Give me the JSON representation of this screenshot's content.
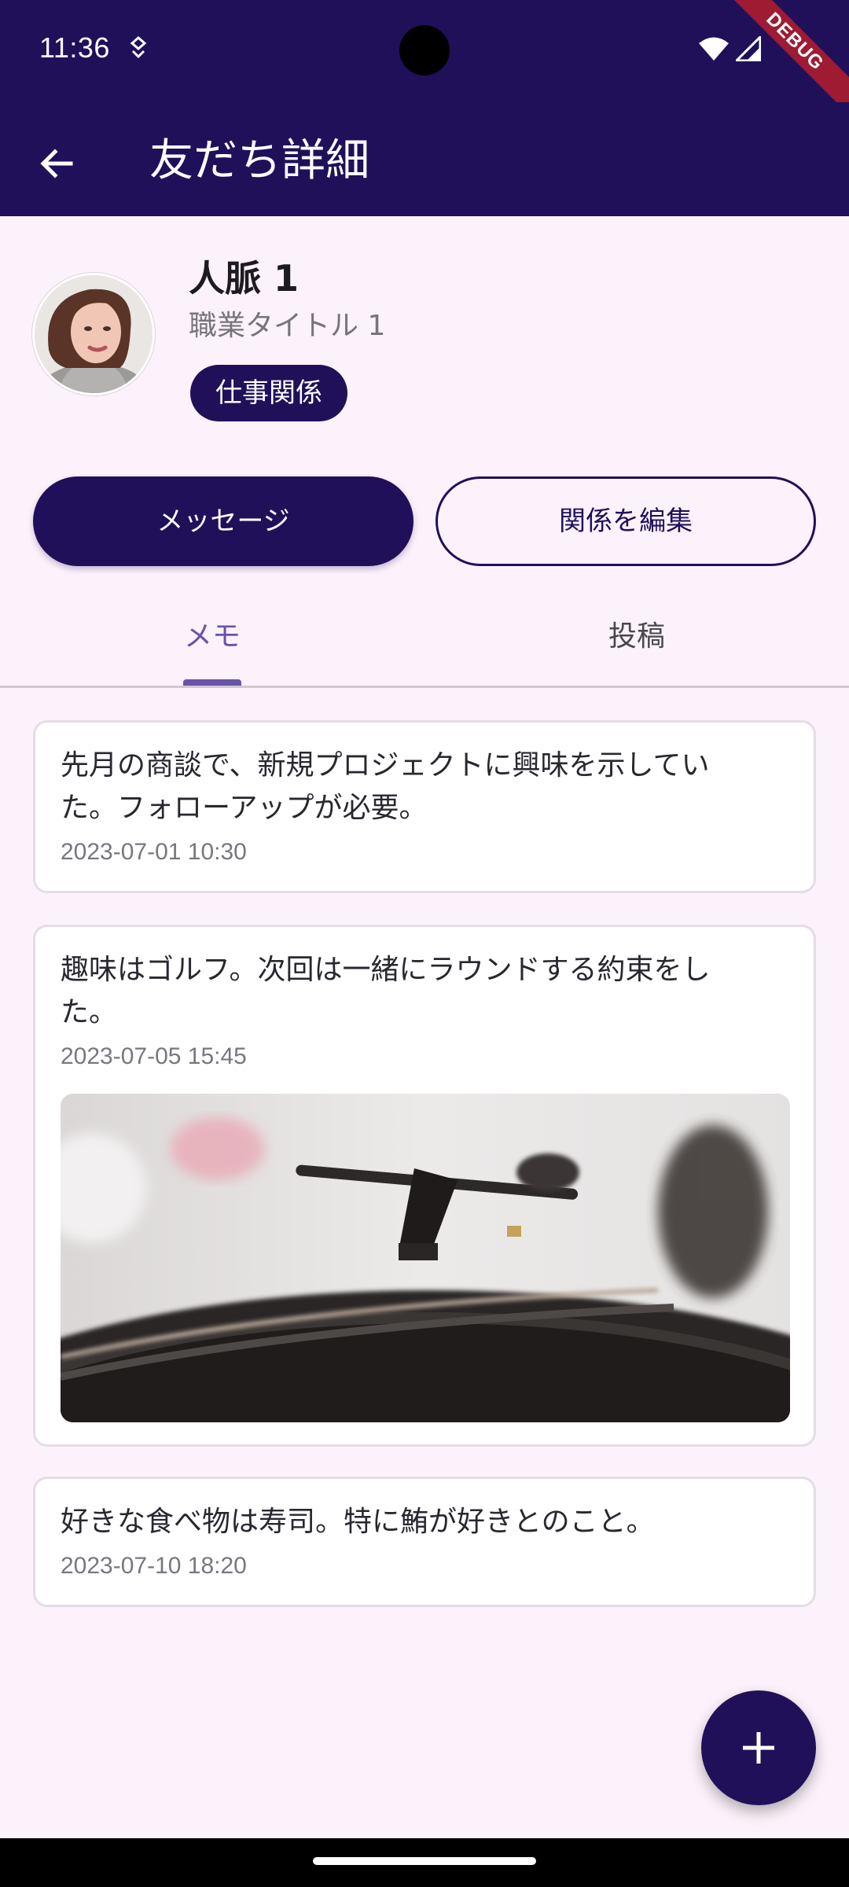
{
  "status_bar": {
    "time": "11:36",
    "debug_label": "DEBUG",
    "icons": [
      "notification-icon",
      "wifi-icon",
      "signal-icon"
    ]
  },
  "app_bar": {
    "title": "友だち詳細",
    "back_icon": "arrow-back-icon"
  },
  "profile": {
    "name": "人脈 1",
    "job_title": "職業タイトル 1",
    "relation_tag": "仕事関係"
  },
  "actions": {
    "message_label": "メッセージ",
    "edit_relation_label": "関係を編集"
  },
  "tabs": {
    "items": [
      {
        "label": "メモ",
        "selected": true
      },
      {
        "label": "投稿",
        "selected": false
      }
    ]
  },
  "memos": [
    {
      "text": "先月の商談で、新規プロジェクトに興味を示していた。フォローアップが必要。",
      "date": "2023-07-01 10:30"
    },
    {
      "text": "趣味はゴルフ。次回は一緒にラウンドする約束をした。",
      "date": "2023-07-05 15:45",
      "image": "turntable-photo"
    },
    {
      "text": "好きな食べ物は寿司。特に鮪が好きとのこと。",
      "date": "2023-07-10 18:20"
    }
  ],
  "fab": {
    "icon": "add-icon"
  },
  "colors": {
    "primary": "#20105A",
    "background": "#FCF2FB",
    "tab_accent": "#6A52A8",
    "debug_ribbon": "#9E1B32"
  }
}
